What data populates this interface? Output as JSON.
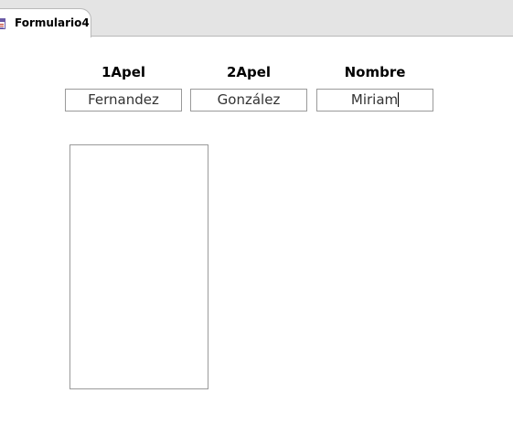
{
  "tab": {
    "title": "Formulario4",
    "icon": "form-icon"
  },
  "fields": {
    "apellido1": {
      "label": "1Apel",
      "value": "Fernandez"
    },
    "apellido2": {
      "label": "2Apel",
      "value": "González"
    },
    "nombre": {
      "label": "Nombre",
      "value": "Miriam"
    }
  },
  "listbox": {
    "items": []
  }
}
